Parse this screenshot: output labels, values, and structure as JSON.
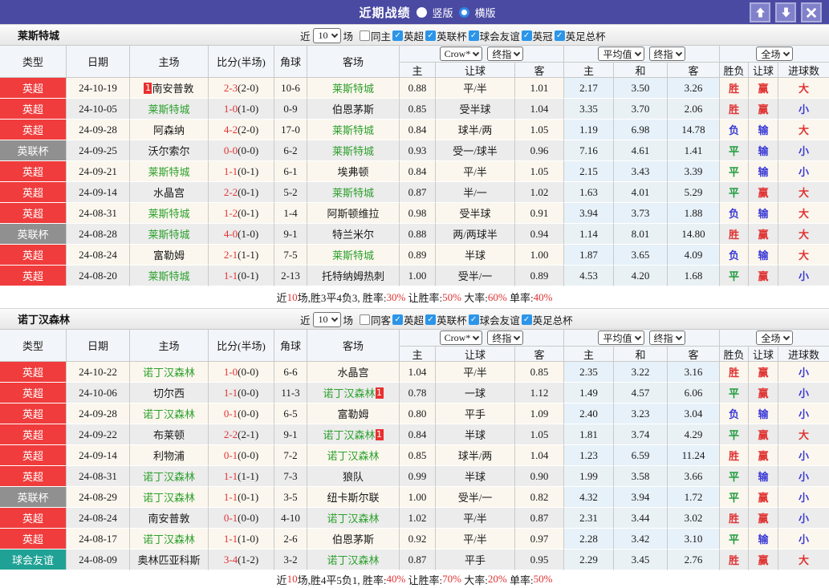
{
  "topbar": {
    "title": "近期战绩",
    "radio_vertical": "竖版",
    "radio_horizontal": "横版",
    "bar_color": "#4a4aa3"
  },
  "table": {
    "cols": [
      "类型",
      "日期",
      "主场",
      "比分(半场)",
      "角球",
      "客场"
    ],
    "sub": [
      "主",
      "让球",
      "客",
      "主",
      "和",
      "客",
      "胜负",
      "让球",
      "进球数"
    ],
    "selects": {
      "crow": "Crow*",
      "final1": "终指",
      "avg": "平均值",
      "final2": "终指",
      "full": "全场"
    }
  },
  "filter_labels": {
    "near": "近",
    "count": "10",
    "games": "场"
  },
  "league_colors": {
    "英超": "#f03c3c",
    "英联杯": "#909090",
    "球会友谊": "#1fa295"
  },
  "result_colors": {
    "胜": "#e03333",
    "平": "#1f9c3d",
    "负": "#3a3ad6",
    "赢": "#e03333",
    "输": "#3a3ad6",
    "大": "#e03333",
    "小": "#3a3ad6"
  },
  "focus_team_color": "#2da02d",
  "sections": [
    {
      "team": "莱斯特城",
      "same_label": "同主",
      "same_checked": false,
      "leagues": [
        {
          "label": "英超",
          "checked": true
        },
        {
          "label": "英联杯",
          "checked": true
        },
        {
          "label": "球会友谊",
          "checked": true
        },
        {
          "label": "英冠",
          "checked": true
        },
        {
          "label": "英足总杯",
          "checked": true
        }
      ],
      "rows": [
        {
          "league": "英超",
          "date": "24-10-19",
          "home": "南安普敦",
          "homeFocus": false,
          "homeBadge": "1",
          "score": "2-3",
          "half": "(2-0)",
          "corners": "10-6",
          "away": "莱斯特城",
          "awayFocus": true,
          "awayBadge": "",
          "odds": [
            "0.88",
            "平/半",
            "1.01"
          ],
          "avg": [
            "2.17",
            "3.50",
            "3.26"
          ],
          "results": [
            "胜",
            "赢",
            "大"
          ]
        },
        {
          "league": "英超",
          "date": "24-10-05",
          "home": "莱斯特城",
          "homeFocus": true,
          "homeBadge": "",
          "score": "1-0",
          "half": "(1-0)",
          "corners": "0-9",
          "away": "伯恩茅斯",
          "awayFocus": false,
          "awayBadge": "",
          "odds": [
            "0.85",
            "受半球",
            "1.04"
          ],
          "avg": [
            "3.35",
            "3.70",
            "2.06"
          ],
          "results": [
            "胜",
            "赢",
            "小"
          ]
        },
        {
          "league": "英超",
          "date": "24-09-28",
          "home": "阿森纳",
          "homeFocus": false,
          "homeBadge": "",
          "score": "4-2",
          "half": "(2-0)",
          "corners": "17-0",
          "away": "莱斯特城",
          "awayFocus": true,
          "awayBadge": "",
          "odds": [
            "0.84",
            "球半/两",
            "1.05"
          ],
          "avg": [
            "1.19",
            "6.98",
            "14.78"
          ],
          "results": [
            "负",
            "输",
            "大"
          ]
        },
        {
          "league": "英联杯",
          "date": "24-09-25",
          "home": "沃尔索尔",
          "homeFocus": false,
          "homeBadge": "",
          "score": "0-0",
          "half": "(0-0)",
          "corners": "6-2",
          "away": "莱斯特城",
          "awayFocus": true,
          "awayBadge": "",
          "odds": [
            "0.93",
            "受一/球半",
            "0.96"
          ],
          "avg": [
            "7.16",
            "4.61",
            "1.41"
          ],
          "results": [
            "平",
            "输",
            "小"
          ]
        },
        {
          "league": "英超",
          "date": "24-09-21",
          "home": "莱斯特城",
          "homeFocus": true,
          "homeBadge": "",
          "score": "1-1",
          "half": "(0-1)",
          "corners": "6-1",
          "away": "埃弗顿",
          "awayFocus": false,
          "awayBadge": "",
          "odds": [
            "0.84",
            "平/半",
            "1.05"
          ],
          "avg": [
            "2.15",
            "3.43",
            "3.39"
          ],
          "results": [
            "平",
            "输",
            "小"
          ]
        },
        {
          "league": "英超",
          "date": "24-09-14",
          "home": "水晶宫",
          "homeFocus": false,
          "homeBadge": "",
          "score": "2-2",
          "half": "(0-1)",
          "corners": "5-2",
          "away": "莱斯特城",
          "awayFocus": true,
          "awayBadge": "",
          "odds": [
            "0.87",
            "半/一",
            "1.02"
          ],
          "avg": [
            "1.63",
            "4.01",
            "5.29"
          ],
          "results": [
            "平",
            "赢",
            "大"
          ]
        },
        {
          "league": "英超",
          "date": "24-08-31",
          "home": "莱斯特城",
          "homeFocus": true,
          "homeBadge": "",
          "score": "1-2",
          "half": "(0-1)",
          "corners": "1-4",
          "away": "阿斯顿维拉",
          "awayFocus": false,
          "awayBadge": "",
          "odds": [
            "0.98",
            "受半球",
            "0.91"
          ],
          "avg": [
            "3.94",
            "3.73",
            "1.88"
          ],
          "results": [
            "负",
            "输",
            "大"
          ]
        },
        {
          "league": "英联杯",
          "date": "24-08-28",
          "home": "莱斯特城",
          "homeFocus": true,
          "homeBadge": "",
          "score": "4-0",
          "half": "(1-0)",
          "corners": "9-1",
          "away": "特兰米尔",
          "awayFocus": false,
          "awayBadge": "",
          "odds": [
            "0.88",
            "两/两球半",
            "0.94"
          ],
          "avg": [
            "1.14",
            "8.01",
            "14.80"
          ],
          "results": [
            "胜",
            "赢",
            "大"
          ]
        },
        {
          "league": "英超",
          "date": "24-08-24",
          "home": "富勒姆",
          "homeFocus": false,
          "homeBadge": "",
          "score": "2-1",
          "half": "(1-1)",
          "corners": "7-5",
          "away": "莱斯特城",
          "awayFocus": true,
          "awayBadge": "",
          "odds": [
            "0.89",
            "半球",
            "1.00"
          ],
          "avg": [
            "1.87",
            "3.65",
            "4.09"
          ],
          "results": [
            "负",
            "输",
            "大"
          ]
        },
        {
          "league": "英超",
          "date": "24-08-20",
          "home": "莱斯特城",
          "homeFocus": true,
          "homeBadge": "",
          "score": "1-1",
          "half": "(0-1)",
          "corners": "2-13",
          "away": "托特纳姆热刺",
          "awayFocus": false,
          "awayBadge": "",
          "odds": [
            "1.00",
            "受半/一",
            "0.89"
          ],
          "avg": [
            "4.53",
            "4.20",
            "1.68"
          ],
          "results": [
            "平",
            "赢",
            "小"
          ]
        }
      ],
      "summary": [
        {
          "t": "近"
        },
        {
          "t": "10",
          "red": true
        },
        {
          "t": "场,胜3平4负3, 胜率:"
        },
        {
          "t": "30%",
          "red": true
        },
        {
          "t": " 让胜率:"
        },
        {
          "t": "50%",
          "red": true
        },
        {
          "t": " 大率:"
        },
        {
          "t": "60%",
          "red": true
        },
        {
          "t": " 单率:"
        },
        {
          "t": "40%",
          "red": true
        }
      ]
    },
    {
      "team": "诺丁汉森林",
      "same_label": "同客",
      "same_checked": false,
      "leagues": [
        {
          "label": "英超",
          "checked": true
        },
        {
          "label": "英联杯",
          "checked": true
        },
        {
          "label": "球会友谊",
          "checked": true
        },
        {
          "label": "英足总杯",
          "checked": true
        }
      ],
      "rows": [
        {
          "league": "英超",
          "date": "24-10-22",
          "home": "诺丁汉森林",
          "homeFocus": true,
          "homeBadge": "",
          "score": "1-0",
          "half": "(0-0)",
          "corners": "6-6",
          "away": "水晶宫",
          "awayFocus": false,
          "awayBadge": "",
          "odds": [
            "1.04",
            "平/半",
            "0.85"
          ],
          "avg": [
            "2.35",
            "3.22",
            "3.16"
          ],
          "results": [
            "胜",
            "赢",
            "小"
          ]
        },
        {
          "league": "英超",
          "date": "24-10-06",
          "home": "切尔西",
          "homeFocus": false,
          "homeBadge": "",
          "score": "1-1",
          "half": "(0-0)",
          "corners": "11-3",
          "away": "诺丁汉森林",
          "awayFocus": true,
          "awayBadge": "1",
          "odds": [
            "0.78",
            "一球",
            "1.12"
          ],
          "avg": [
            "1.49",
            "4.57",
            "6.06"
          ],
          "results": [
            "平",
            "赢",
            "小"
          ]
        },
        {
          "league": "英超",
          "date": "24-09-28",
          "home": "诺丁汉森林",
          "homeFocus": true,
          "homeBadge": "",
          "score": "0-1",
          "half": "(0-0)",
          "corners": "6-5",
          "away": "富勒姆",
          "awayFocus": false,
          "awayBadge": "",
          "odds": [
            "0.80",
            "平手",
            "1.09"
          ],
          "avg": [
            "2.40",
            "3.23",
            "3.04"
          ],
          "results": [
            "负",
            "输",
            "小"
          ]
        },
        {
          "league": "英超",
          "date": "24-09-22",
          "home": "布莱顿",
          "homeFocus": false,
          "homeBadge": "",
          "score": "2-2",
          "half": "(2-1)",
          "corners": "9-1",
          "away": "诺丁汉森林",
          "awayFocus": true,
          "awayBadge": "1",
          "odds": [
            "0.84",
            "半球",
            "1.05"
          ],
          "avg": [
            "1.81",
            "3.74",
            "4.29"
          ],
          "results": [
            "平",
            "赢",
            "大"
          ]
        },
        {
          "league": "英超",
          "date": "24-09-14",
          "home": "利物浦",
          "homeFocus": false,
          "homeBadge": "",
          "score": "0-1",
          "half": "(0-0)",
          "corners": "7-2",
          "away": "诺丁汉森林",
          "awayFocus": true,
          "awayBadge": "",
          "odds": [
            "0.85",
            "球半/两",
            "1.04"
          ],
          "avg": [
            "1.23",
            "6.59",
            "11.24"
          ],
          "results": [
            "胜",
            "赢",
            "小"
          ]
        },
        {
          "league": "英超",
          "date": "24-08-31",
          "home": "诺丁汉森林",
          "homeFocus": true,
          "homeBadge": "",
          "score": "1-1",
          "half": "(1-1)",
          "corners": "7-3",
          "away": "狼队",
          "awayFocus": false,
          "awayBadge": "",
          "odds": [
            "0.99",
            "半球",
            "0.90"
          ],
          "avg": [
            "1.99",
            "3.58",
            "3.66"
          ],
          "results": [
            "平",
            "输",
            "小"
          ]
        },
        {
          "league": "英联杯",
          "date": "24-08-29",
          "home": "诺丁汉森林",
          "homeFocus": true,
          "homeBadge": "",
          "score": "1-1",
          "half": "(0-1)",
          "corners": "3-5",
          "away": "纽卡斯尔联",
          "awayFocus": false,
          "awayBadge": "",
          "odds": [
            "1.00",
            "受半/一",
            "0.82"
          ],
          "avg": [
            "4.32",
            "3.94",
            "1.72"
          ],
          "results": [
            "平",
            "赢",
            "小"
          ]
        },
        {
          "league": "英超",
          "date": "24-08-24",
          "home": "南安普敦",
          "homeFocus": false,
          "homeBadge": "",
          "score": "0-1",
          "half": "(0-0)",
          "corners": "4-10",
          "away": "诺丁汉森林",
          "awayFocus": true,
          "awayBadge": "",
          "odds": [
            "1.02",
            "平/半",
            "0.87"
          ],
          "avg": [
            "2.31",
            "3.44",
            "3.02"
          ],
          "results": [
            "胜",
            "赢",
            "小"
          ]
        },
        {
          "league": "英超",
          "date": "24-08-17",
          "home": "诺丁汉森林",
          "homeFocus": true,
          "homeBadge": "",
          "score": "1-1",
          "half": "(1-0)",
          "corners": "2-6",
          "away": "伯恩茅斯",
          "awayFocus": false,
          "awayBadge": "",
          "odds": [
            "0.92",
            "平/半",
            "0.97"
          ],
          "avg": [
            "2.28",
            "3.42",
            "3.10"
          ],
          "results": [
            "平",
            "输",
            "小"
          ]
        },
        {
          "league": "球会友谊",
          "date": "24-08-09",
          "home": "奥林匹亚科斯",
          "homeFocus": false,
          "homeBadge": "",
          "score": "3-4",
          "half": "(1-2)",
          "corners": "3-2",
          "away": "诺丁汉森林",
          "awayFocus": true,
          "awayBadge": "",
          "odds": [
            "0.87",
            "平手",
            "0.95"
          ],
          "avg": [
            "2.29",
            "3.45",
            "2.76"
          ],
          "results": [
            "胜",
            "赢",
            "大"
          ]
        }
      ],
      "summary": [
        {
          "t": "近"
        },
        {
          "t": "10",
          "red": true
        },
        {
          "t": "场,胜4平5负1, 胜率:"
        },
        {
          "t": "40%",
          "red": true
        },
        {
          "t": " 让胜率:"
        },
        {
          "t": "70%",
          "red": true
        },
        {
          "t": " 大率:"
        },
        {
          "t": "20%",
          "red": true
        },
        {
          "t": " 单率:"
        },
        {
          "t": "50%",
          "red": true
        }
      ]
    }
  ]
}
